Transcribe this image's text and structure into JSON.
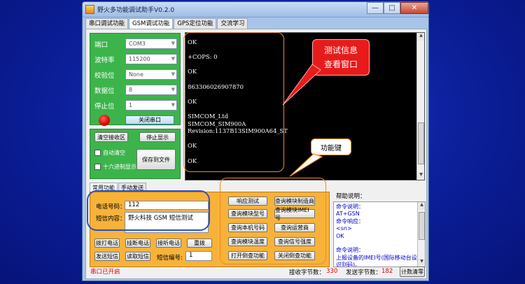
{
  "window": {
    "title": "野火多功能调试助手V0.2.0",
    "minimize": "—",
    "maximize": "□",
    "close": "✕"
  },
  "tabs": [
    "串口调试功能",
    "GSM调试功能",
    "GPS定位功能",
    "交流学习"
  ],
  "serial": {
    "port_label": "端口",
    "port_value": "COM3",
    "baud_label": "波特率",
    "baud_value": "115200",
    "parity_label": "校验位",
    "parity_value": "None",
    "databits_label": "数据位",
    "databits_value": "8",
    "stopbits_label": "停止位",
    "stopbits_value": "1",
    "close_port_button": "关闭串口",
    "led_color": "#e00000"
  },
  "receive": {
    "clear_button": "清空接收区",
    "stop_button": "停止显示",
    "auto_clear_label": "自动清空",
    "hex_display_label": "十六进制显示",
    "save_button": "保存到文件"
  },
  "terminal": {
    "text": "OK\n\n+COPS: 0\n\nOK\n\n863306026907870\n\nOK\n\nSIMCOM_Ltd\nSIMCOM_SIM900A\nRevision:1137B13SIM900A64_ST\n\nOK\n\nOK"
  },
  "bottom_tabs": [
    "常用功能",
    "手动发送"
  ],
  "func": {
    "phone_label": "电话号码：",
    "phone_value": "112",
    "sms_label": "短信内容：",
    "sms_value": "野火科技 GSM 短信测试",
    "call_button": "拨打电话",
    "hangup_button": "挂断电话",
    "answer_button": "接听电话",
    "redial_button": "重拨",
    "send_sms_button": "发送短信",
    "read_sms_button": "读取短信",
    "sms_index_label": "短信编号:",
    "sms_index_value": "1",
    "grid_buttons": [
      "响应测试",
      "查询模块制造商",
      "查询模块型号",
      "查询模块IMEI号",
      "查询本机号码",
      "查询运营商",
      "查询模块温度",
      "查询信号强度",
      "打开倒查功能",
      "关闭倒查功能"
    ]
  },
  "help": {
    "label": "帮助说明：",
    "text": "命令说明：\nAT+GSN\n命令响应：\n<sn>\nOK\n\n命令说明：\n上报设备的IMEI号(国际移动台设备\n识别码)。"
  },
  "status": {
    "port_status": "串口已开启",
    "recv_label": "接收字节数：",
    "recv_value": "330",
    "send_label": "发送字节数：",
    "send_value": "182",
    "clear_count_button": "计数清零"
  },
  "annotations": {
    "terminal_note_line1": "测试信息",
    "terminal_note_line2": "查看窗口",
    "func_key_note": "功能键",
    "accent": "#f28b1e",
    "red": "#e81b1b"
  }
}
